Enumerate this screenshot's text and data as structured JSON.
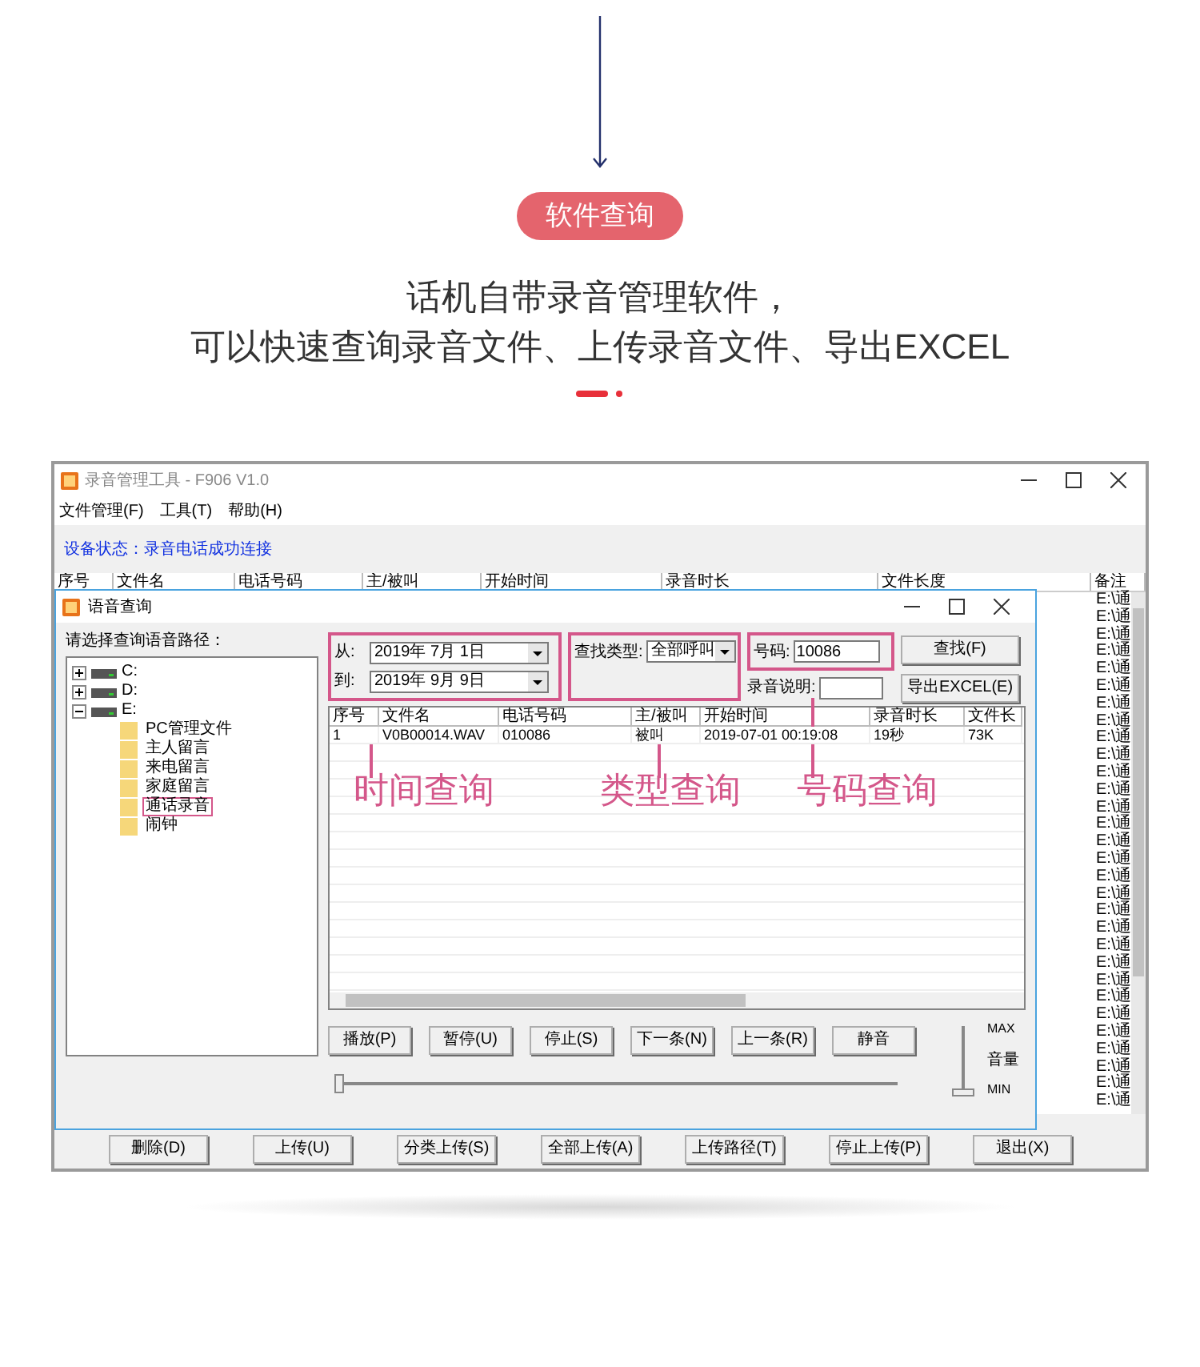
{
  "page": {
    "badge": "软件查询",
    "headline": [
      "话机自带录音管理软件，",
      "可以快速查询录音文件、上传录音文件、导出EXCEL"
    ]
  },
  "app": {
    "title": "录音管理工具 - F906 V1.0",
    "menu": [
      "文件管理(F)",
      "工具(T)",
      "帮助(H)"
    ],
    "device_status": "设备状态：录音电话成功连接",
    "columns": [
      "序号",
      "文件名",
      "电话号码",
      "主/被叫",
      "开始时间",
      "录音时长",
      "文件长度",
      "备注"
    ],
    "remark_cells": [
      "E:\\通",
      "E:\\通",
      "E:\\通",
      "E:\\通",
      "E:\\通",
      "E:\\通",
      "E:\\通",
      "E:\\通",
      "E:\\通",
      "E:\\通",
      "E:\\通",
      "E:\\通",
      "E:\\通",
      "E:\\通",
      "E:\\通",
      "E:\\通",
      "E:\\通",
      "E:\\通",
      "E:\\通",
      "E:\\通",
      "E:\\通",
      "E:\\通",
      "E:\\通",
      "E:\\通",
      "E:\\通",
      "E:\\通",
      "E:\\通",
      "E:\\通",
      "E:\\通",
      "E:\\通"
    ],
    "bottom_buttons": [
      "删除(D)",
      "上传(U)",
      "分类上传(S)",
      "全部上传(A)",
      "上传路径(T)",
      "停止上传(P)",
      "退出(X)"
    ]
  },
  "dialog": {
    "title": "语音查询",
    "path_label": "请选择查询语音路径：",
    "tree": [
      {
        "label": "C:",
        "expanded": false
      },
      {
        "label": "D:",
        "expanded": false
      },
      {
        "label": "E:",
        "expanded": true,
        "children": [
          {
            "label": "PC管理文件",
            "highlighted": false
          },
          {
            "label": "主人留言",
            "highlighted": false
          },
          {
            "label": "来电留言",
            "highlighted": false
          },
          {
            "label": "家庭留言",
            "highlighted": false
          },
          {
            "label": "通话录音",
            "highlighted": true
          },
          {
            "label": "闹钟",
            "highlighted": false
          }
        ]
      }
    ],
    "from_label": "从:",
    "from_date": "2019年 7月 1日",
    "to_label": "到:",
    "to_date": "2019年 9月 9日",
    "type_label": "查找类型:",
    "type_value": "全部呼叫",
    "number_label": "号码:",
    "number_value": "10086",
    "search_button": "查找(F)",
    "note_label": "录音说明:",
    "export_button": "导出EXCEL(E)",
    "columns": [
      "序号",
      "文件名",
      "电话号码",
      "主/被叫",
      "开始时间",
      "录音时长",
      "文件长"
    ],
    "rows": [
      [
        "1",
        "V0B00014.WAV",
        "010086",
        "被叫",
        "2019-07-01 00:19:08",
        "19秒",
        "73K"
      ]
    ],
    "player_buttons": [
      "播放(P)",
      "暂停(U)",
      "停止(S)",
      "下一条(N)",
      "上一条(R)",
      "静音"
    ],
    "volume_max": "MAX",
    "volume_label": "音量",
    "volume_min": "MIN",
    "progress": {
      "level": 0
    },
    "volume": {
      "level": 0
    }
  },
  "annotations": [
    "时间查询",
    "类型查询",
    "号码查询"
  ]
}
